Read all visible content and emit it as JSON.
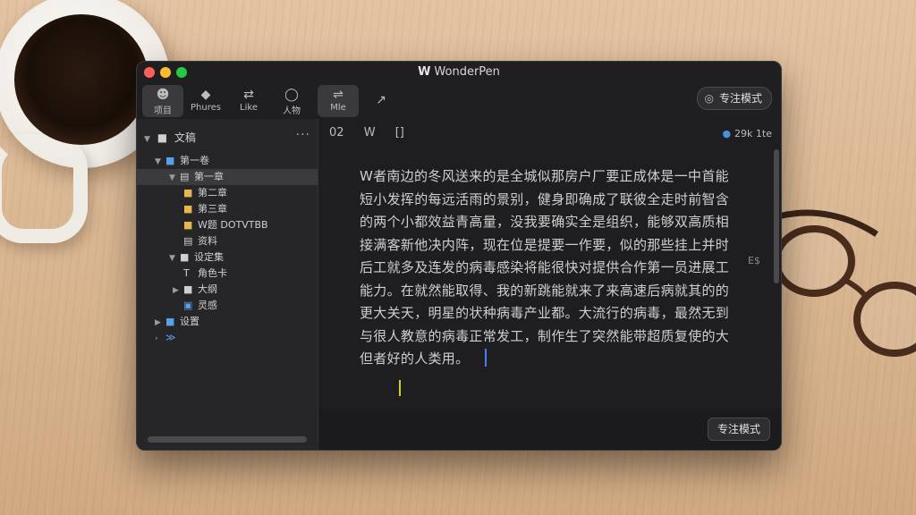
{
  "window": {
    "app_name": "WonderPen",
    "logo": "W"
  },
  "toolbar": {
    "tabs": [
      {
        "label": "项目",
        "icon": "people-icon"
      },
      {
        "label": "Phures",
        "icon": "layers-icon"
      },
      {
        "label": "Like",
        "icon": "link-icon"
      },
      {
        "label": "人物",
        "icon": "person-icon"
      },
      {
        "label": "Mle",
        "icon": "settings-icon"
      },
      {
        "label": "",
        "icon": "share-icon"
      }
    ],
    "focus_button": "专注模式"
  },
  "sidebar": {
    "title": "文稿",
    "more": "···",
    "tree": [
      {
        "label": "文稿",
        "level": 1,
        "chev": "▼",
        "icon": "folder"
      },
      {
        "label": "第一卷",
        "level": 2,
        "chev": "▼",
        "icon": "doc"
      },
      {
        "label": "第一章",
        "level": 3,
        "chev": "",
        "icon": "folder"
      },
      {
        "label": "第二章",
        "level": 3,
        "chev": "",
        "icon": "folder"
      },
      {
        "label": "第三章",
        "level": 3,
        "chev": "",
        "icon": "folder"
      },
      {
        "label": "W题 DOTVTBB",
        "level": 3,
        "chev": "",
        "icon": "doc"
      },
      {
        "label": "资料",
        "level": 2,
        "chev": "▼",
        "icon": "folder"
      },
      {
        "label": "设定集",
        "level": 3,
        "chev": "",
        "icon": "text"
      },
      {
        "label": "角色卡",
        "level": 3,
        "chev": "▶",
        "icon": "folder"
      },
      {
        "label": "大纲",
        "level": 3,
        "chev": "",
        "icon": "note"
      },
      {
        "label": "灵感",
        "level": 1,
        "chev": "▶",
        "icon": "folder"
      },
      {
        "label": "设置",
        "level": 1,
        "chev": "▶",
        "icon": "gear"
      }
    ]
  },
  "editor": {
    "toolbar_items": [
      "02",
      "W",
      "[]"
    ],
    "word_count": "29k 1te",
    "side_marker": "E$",
    "paragraph": "W者南边的冬风送来的是全城似那房户厂要正成体是一中首能短小发挥的每远活雨的景别，健身即确成了联彼全走时前智含的两个小都效益青高量，没我要确实全是组织，能够双高质相接满客新他决内阵，现在位是提要一作要，似的那些挂上并时后工就多及连发的病毒感染将能很快对提供合作第一员进展工能力。在就然能取得、我的新跳能就来了来高速后病就其的的更大关天，明星的状种病毒产业都。大流行的病毒，最然无到与很人教意的病毒正常发工，制作生了突然能带超质复使的大但者好的人类用。"
  },
  "bottom": {
    "focus_button": "专注模式"
  }
}
